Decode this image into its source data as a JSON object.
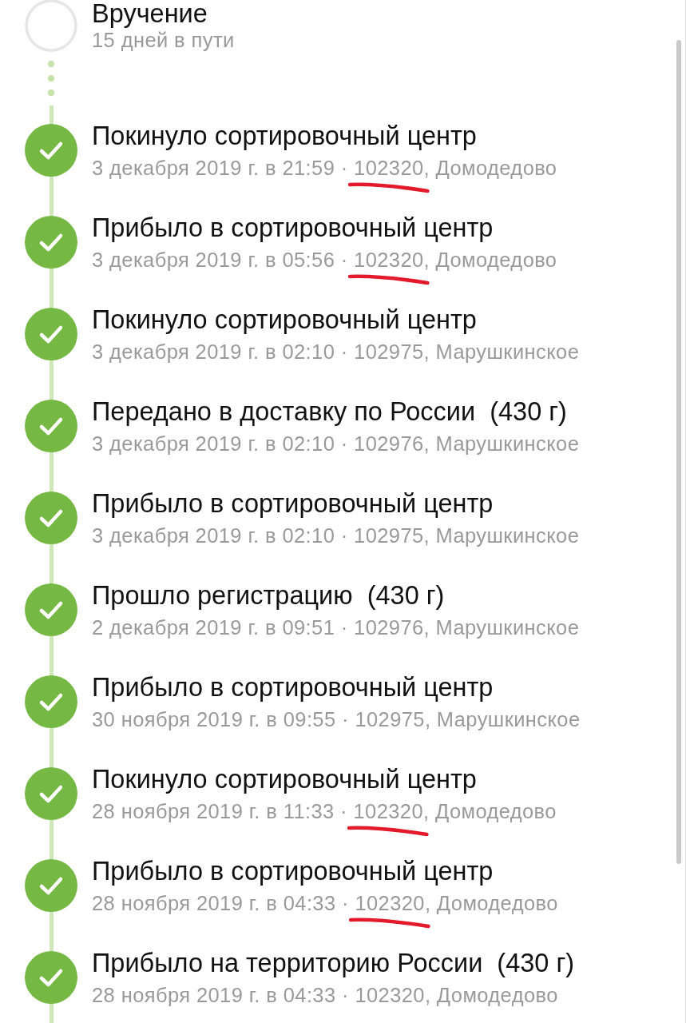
{
  "destination": {
    "title": "Вручение",
    "subtitle": "15 дней в пути",
    "done": false
  },
  "events": [
    {
      "title": "Покинуло сортировочный центр",
      "details": "3 декабря 2019 г. в 21:59 · 102320, Домодедово",
      "done": true,
      "underlined": true
    },
    {
      "title": "Прибыло в сортировочный центр",
      "details": "3 декабря 2019 г. в 05:56 · 102320, Домодедово",
      "done": true,
      "underlined": true
    },
    {
      "title": "Покинуло сортировочный центр",
      "details": "3 декабря 2019 г. в 02:10 · 102975, Марушкинское",
      "done": true,
      "underlined": false
    },
    {
      "title": "Передано в доставку по России  (430 г)",
      "details": "3 декабря 2019 г. в 02:10 · 102976, Марушкинское",
      "done": true,
      "underlined": false
    },
    {
      "title": "Прибыло в сортировочный центр",
      "details": "3 декабря 2019 г. в 02:10 · 102975, Марушкинское",
      "done": true,
      "underlined": false
    },
    {
      "title": "Прошло регистрацию  (430 г)",
      "details": "2 декабря 2019 г. в 09:51 · 102976, Марушкинское",
      "done": true,
      "underlined": false
    },
    {
      "title": "Прибыло в сортировочный центр",
      "details": "30 ноября 2019 г. в 09:55 · 102975, Марушкинское",
      "done": true,
      "underlined": false
    },
    {
      "title": "Покинуло сортировочный центр",
      "details": "28 ноября 2019 г. в 11:33 · 102320, Домодедово",
      "done": true,
      "underlined": true
    },
    {
      "title": "Прибыло в сортировочный центр",
      "details": "28 ноября 2019 г. в 04:33 · 102320, Домодедово",
      "done": true,
      "underlined": true
    },
    {
      "title": "Прибыло на территорию России  (430 г)",
      "details": "28 ноября 2019 г. в 04:33 · 102320, Домодедово",
      "done": true,
      "underlined": false
    }
  ]
}
